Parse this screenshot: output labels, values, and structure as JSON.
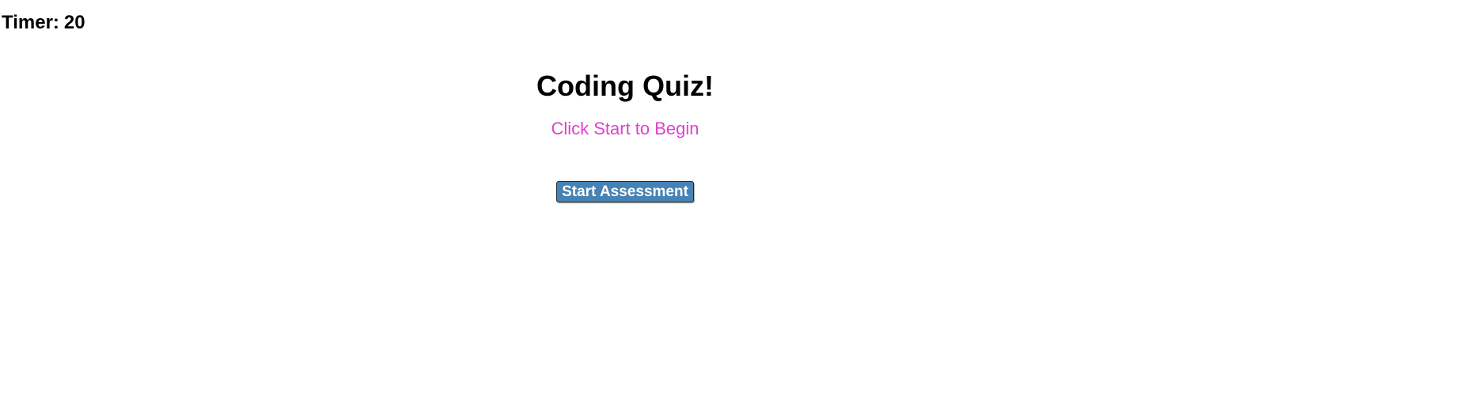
{
  "timer": {
    "label": "Timer:",
    "value": "20"
  },
  "quiz": {
    "title": "Coding Quiz!",
    "subtitle": "Click Start to Begin",
    "start_label": "Start Assessment"
  },
  "colors": {
    "subtitle": "#e23fd0",
    "button_bg": "#4682b4",
    "button_text": "#ffffff"
  }
}
